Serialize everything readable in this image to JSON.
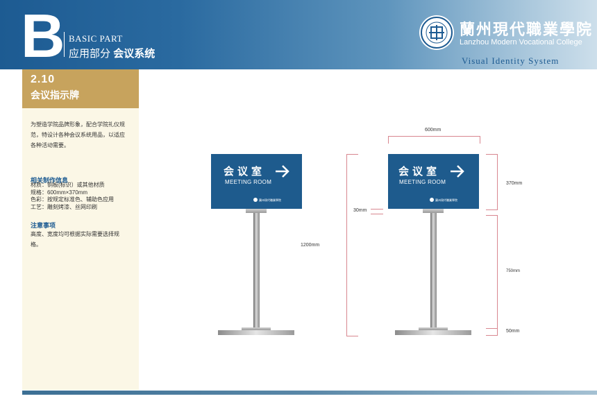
{
  "header": {
    "letter": "B",
    "basic_part": "BASIC PART",
    "part_title_a": "应用部分",
    "part_title_b": "会议系统",
    "college_cn": "蘭州現代職業學院",
    "college_en": "Lanzhou Modern Vocational College",
    "visual_identity": "Visual Identity System"
  },
  "section": {
    "number": "2.10",
    "title": "会议指示牌"
  },
  "sidebar": {
    "intro": [
      "为塑造学院品牌形象，配合学院礼仪规",
      "范，特设计各种会议系统用品，以适应",
      "各种活动需要。"
    ],
    "spec_heading": "相关制作信息",
    "spec_lines": [
      "材质：铜板(标识）或其他材质",
      "规格：600mm×370mm",
      "色彩：按规定标准色、辅助色应用",
      "工艺：雕刻烤漆、丝网印刷"
    ],
    "notes_heading": "注意事项",
    "notes_lines": [
      "高度、宽度均可根据实际需要选择规",
      "格。"
    ]
  },
  "sign": {
    "cn": "会议室",
    "en": "MEETING ROOM",
    "arrow": "→",
    "logo_text": "蘭州現代職業學院"
  },
  "dimensions": {
    "width": "600mm",
    "panel_height": "370mm",
    "gap": "30mm",
    "total_height": "1200mm",
    "pole_height": "750mm",
    "base_height": "50mm"
  },
  "colors": {
    "primary_blue": "#1e5b8d",
    "gold": "#c7a35d",
    "cream": "#fbf7e6"
  }
}
